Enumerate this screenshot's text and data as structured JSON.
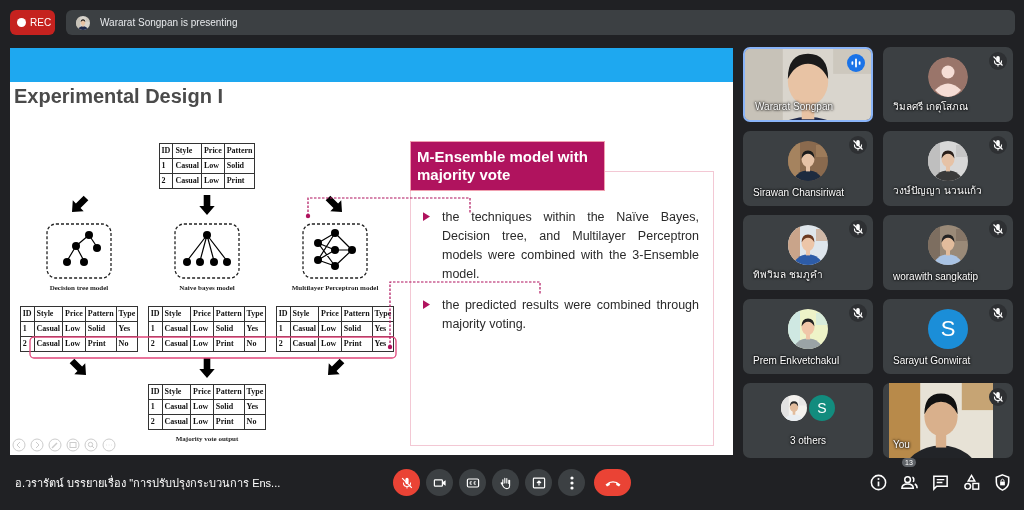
{
  "recording": {
    "label": "REC"
  },
  "presenting": {
    "text": "Wararat Songpan is presenting"
  },
  "slide": {
    "title": "Experimental Design I",
    "input_table": {
      "columns": [
        "ID",
        "Style",
        "Price",
        "Pattern"
      ],
      "rows": [
        [
          "1",
          "Casual",
          "Low",
          "Solid"
        ],
        [
          "2",
          "Casual",
          "Low",
          "Print"
        ]
      ]
    },
    "models": [
      {
        "kind": "tree",
        "name": "Decision tree model",
        "table": {
          "columns": [
            "ID",
            "Style",
            "Price",
            "Pattern",
            "Type"
          ],
          "rows": [
            [
              "1",
              "Casual",
              "Low",
              "Solid",
              "Yes"
            ],
            [
              "2",
              "Casual",
              "Low",
              "Print",
              "No"
            ]
          ]
        }
      },
      {
        "kind": "bayes",
        "name": "Naive bayes model",
        "table": {
          "columns": [
            "ID",
            "Style",
            "Price",
            "Pattern",
            "Type"
          ],
          "rows": [
            [
              "1",
              "Casual",
              "Low",
              "Solid",
              "Yes"
            ],
            [
              "2",
              "Casual",
              "Low",
              "Print",
              "No"
            ]
          ]
        }
      },
      {
        "kind": "mlp",
        "name": "Multilayer Perceptron model",
        "table": {
          "columns": [
            "ID",
            "Style",
            "Price",
            "Pattern",
            "Type"
          ],
          "rows": [
            [
              "1",
              "Casual",
              "Low",
              "Solid",
              "Yes"
            ],
            [
              "2",
              "Casual",
              "Low",
              "Print",
              "Yes"
            ]
          ]
        }
      }
    ],
    "output_table": {
      "columns": [
        "ID",
        "Style",
        "Price",
        "Pattern",
        "Type"
      ],
      "rows": [
        [
          "1",
          "Casual",
          "Low",
          "Solid",
          "Yes"
        ],
        [
          "2",
          "Casual",
          "Low",
          "Print",
          "No"
        ]
      ]
    },
    "output_caption": "Majority vote output",
    "callout": {
      "heading": "M-Ensemble model with majority vote",
      "bullets": [
        "the techniques within the Naïve Bayes, Decision tree, and Multilayer Perceptron models were combined with the 3-Ensemble model.",
        "the predicted results were combined through majority voting."
      ]
    }
  },
  "participants": [
    {
      "name": "Wararat Songpan",
      "kind": "video",
      "speaking": true,
      "muted": false
    },
    {
      "name": "วิมลศรี เกตุโสภณ",
      "kind": "default",
      "speaking": false,
      "muted": true
    },
    {
      "name": "Sirawan Chansiriwat",
      "speaking": false,
      "muted": true
    },
    {
      "name": "วงษ์ปัญญา นวนแก้ว",
      "speaking": false,
      "muted": true
    },
    {
      "name": "ทิพวิมล ชมภูคำ",
      "speaking": false,
      "muted": true
    },
    {
      "name": "worawith sangkatip",
      "speaking": false,
      "muted": true
    },
    {
      "name": "Prem Enkvetchakul",
      "speaking": false,
      "muted": true
    },
    {
      "name": "Sarayut Gonwirat",
      "kind": "letter",
      "letter": "S",
      "color": "#1b8ed8",
      "speaking": false,
      "muted": true
    },
    {
      "name": "3 others",
      "kind": "others",
      "letter": "S",
      "color": "#128c7e",
      "speaking": false,
      "muted": false
    },
    {
      "name": "You",
      "kind": "self",
      "speaking": false,
      "muted": true
    }
  ],
  "meeting_title": "อ.วรารัตน์ บรรยายเรื่อง \"การปรับปรุงกระบวนการ Ens...",
  "controls": [
    {
      "kind": "mic",
      "muted": true
    },
    {
      "kind": "camera"
    },
    {
      "kind": "captions"
    },
    {
      "kind": "hand"
    },
    {
      "kind": "present"
    },
    {
      "kind": "more"
    },
    {
      "kind": "end_call"
    }
  ],
  "side_controls": [
    {
      "kind": "info"
    },
    {
      "kind": "people",
      "badge": "13"
    },
    {
      "kind": "chat"
    },
    {
      "kind": "activities"
    },
    {
      "kind": "security"
    }
  ]
}
